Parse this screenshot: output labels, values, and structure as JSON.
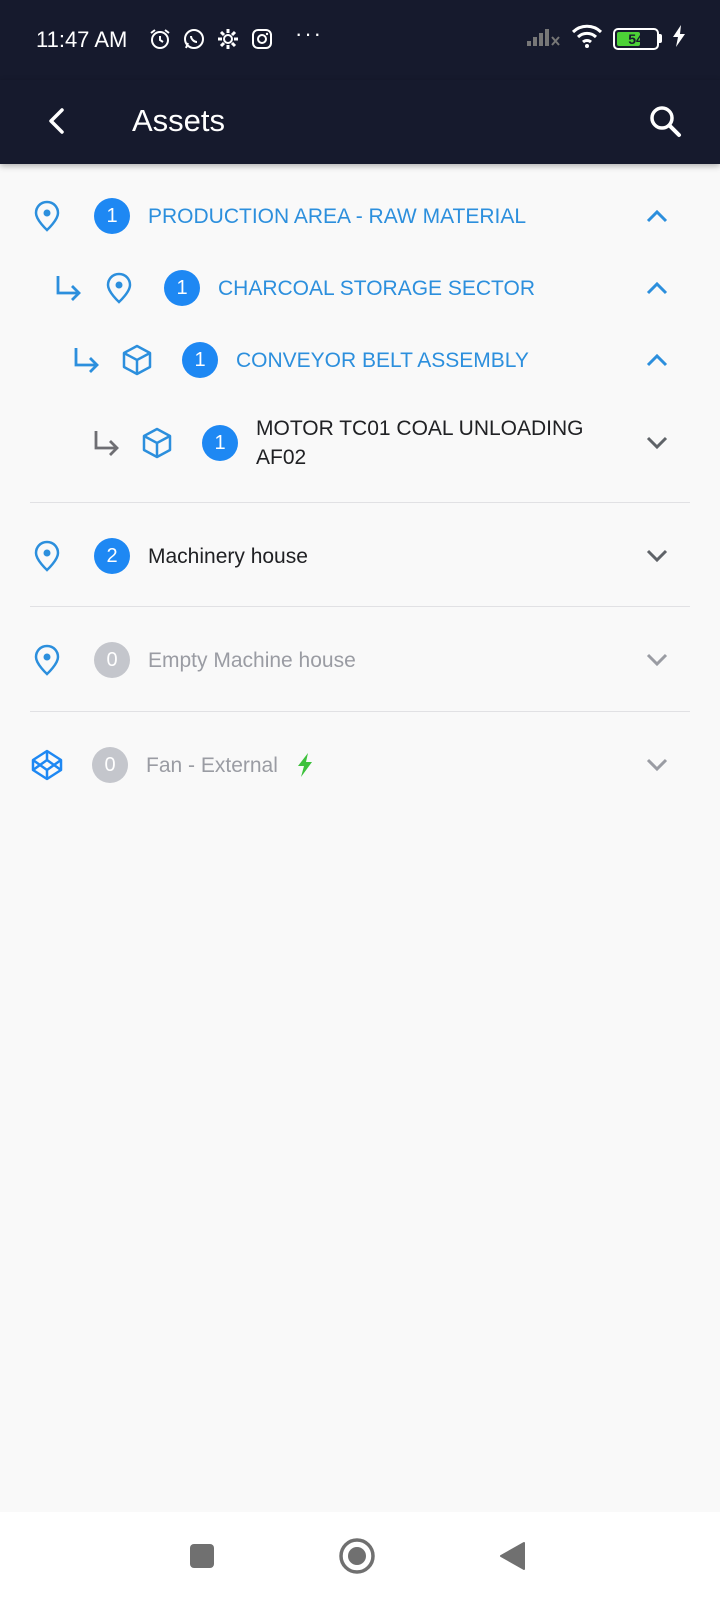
{
  "status_bar": {
    "time": "11:47 AM",
    "icons": [
      "alarm-icon",
      "whatsapp-icon",
      "settings-icon",
      "instagram-icon"
    ],
    "more": "···",
    "battery_level": "54"
  },
  "app_bar": {
    "title": "Assets",
    "back_icon": "chevron-left-icon",
    "search_icon": "search-icon"
  },
  "tree": {
    "rows": [
      {
        "label": "PRODUCTION AREA - RAW MATERIAL",
        "count": "1",
        "icon": "location-pin-icon",
        "state": "expanded"
      },
      {
        "label": "CHARCOAL STORAGE SECTOR",
        "count": "1",
        "icon": "location-pin-icon",
        "state": "expanded"
      },
      {
        "label": "CONVEYOR BELT ASSEMBLY",
        "count": "1",
        "icon": "cube-icon",
        "state": "expanded"
      },
      {
        "label_line1": "MOTOR TC01 COAL UNLOADING",
        "label_line2": "AF02",
        "count": "1",
        "icon": "cube-icon",
        "state": "collapsed"
      },
      {
        "label": "Machinery house",
        "count": "2",
        "icon": "location-pin-icon",
        "state": "collapsed"
      },
      {
        "label": "Empty Machine house",
        "count": "0",
        "icon": "location-pin-icon",
        "state": "collapsed"
      },
      {
        "label": "Fan - External",
        "count": "0",
        "icon": "codepen-cube-icon",
        "extra_icon": "lightning-bolt-icon",
        "state": "collapsed"
      }
    ]
  },
  "colors": {
    "header": "#161a2d",
    "accent": "#1e88f3",
    "blue_text": "#2c8fdd",
    "muted": "#9a9ca3",
    "bolt": "#3cc13b"
  },
  "nav_bar": {
    "buttons": [
      "recent-apps-icon",
      "home-icon",
      "back-icon"
    ]
  }
}
